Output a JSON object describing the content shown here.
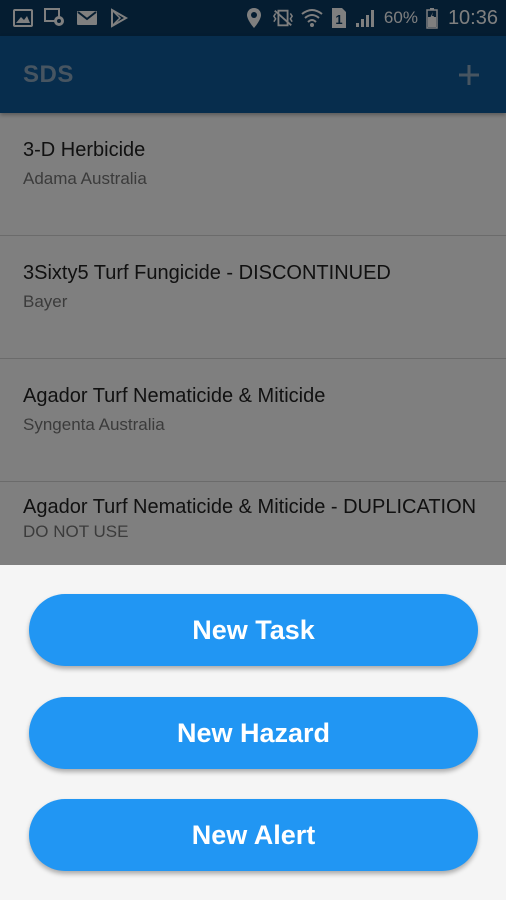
{
  "status_bar": {
    "battery_percent": "60%",
    "time": "10:36",
    "sim_label": "1",
    "icons_left": [
      "gallery-icon",
      "sync-settings-icon",
      "mail-icon",
      "play-store-icon"
    ],
    "icons_right": [
      "location-icon",
      "vibrate-icon",
      "wifi-icon",
      "sim-icon",
      "signal-icon",
      "battery-icon"
    ]
  },
  "app_bar": {
    "title": "SDS",
    "add_icon": "plus-icon"
  },
  "list": {
    "items": [
      {
        "title": "3-D Herbicide",
        "subtitle": "Adama Australia"
      },
      {
        "title": "3Sixty5 Turf Fungicide - DISCONTINUED",
        "subtitle": "Bayer"
      },
      {
        "title": "Agador Turf Nematicide & Miticide",
        "subtitle": "Syngenta Australia"
      },
      {
        "title": "Agador Turf Nematicide & Miticide - DUPLICATION",
        "subtitle": "DO NOT USE"
      }
    ]
  },
  "bottom_sheet": {
    "new_task_label": "New Task",
    "new_hazard_label": "New Hazard",
    "new_alert_label": "New Alert"
  },
  "colors": {
    "status_bar": "#0a3a63",
    "app_bar": "#0e5a9a",
    "action_button": "#2196f3",
    "sheet_background": "#f5f5f5"
  }
}
